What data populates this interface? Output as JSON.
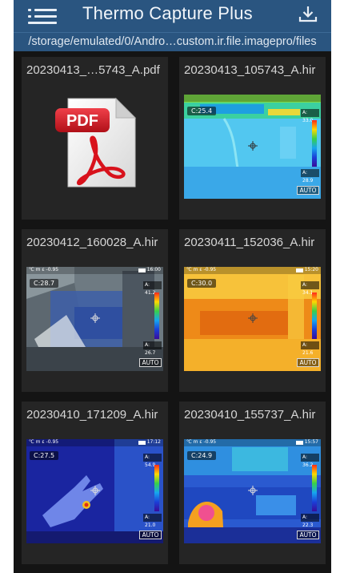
{
  "header": {
    "title": "Thermo Capture Plus",
    "path": "/storage/emulated/0/Andro…custom.ir.file.imagepro/files"
  },
  "files": [
    {
      "name": "20230413_…5743_A.pdf",
      "kind": "pdf",
      "pdf_label": "PDF"
    },
    {
      "name": "20230413_105743_A.hir",
      "kind": "thermal",
      "center": "C:25.4",
      "max": "A: 33.0",
      "min": "A: 28.9",
      "units": "",
      "time": "",
      "auto": "AUTO"
    },
    {
      "name": "20230412_160028_A.hir",
      "kind": "thermal",
      "center": "C:28.7",
      "max": "A: 41.2",
      "min": "A: 26.7",
      "units": "℃ m ε -0.95",
      "time": "16:00",
      "auto": "AUTO"
    },
    {
      "name": "20230411_152036_A.hir",
      "kind": "thermal",
      "center": "C:30.0",
      "max": "A: 34.1",
      "min": "A: 21.6",
      "units": "℃ m ε -0.95",
      "time": "15:20",
      "auto": "AUTO"
    },
    {
      "name": "20230410_171209_A.hir",
      "kind": "thermal",
      "center": "C:27.5",
      "max": "A: 54.9",
      "min": "A: 21.0",
      "units": "℃ m ε -0.95",
      "time": "17:12",
      "auto": "AUTO"
    },
    {
      "name": "20230410_155737_A.hir",
      "kind": "thermal",
      "center": "C:24.9",
      "max": "A: 36.2",
      "min": "A: 22.3",
      "units": "℃ m ε -0.95",
      "time": "15:57",
      "auto": "AUTO"
    }
  ],
  "colors": {
    "header_bg": "#2a5580",
    "background": "#141414",
    "card_bg": "#252525",
    "card_text": "#d6d6d6"
  }
}
